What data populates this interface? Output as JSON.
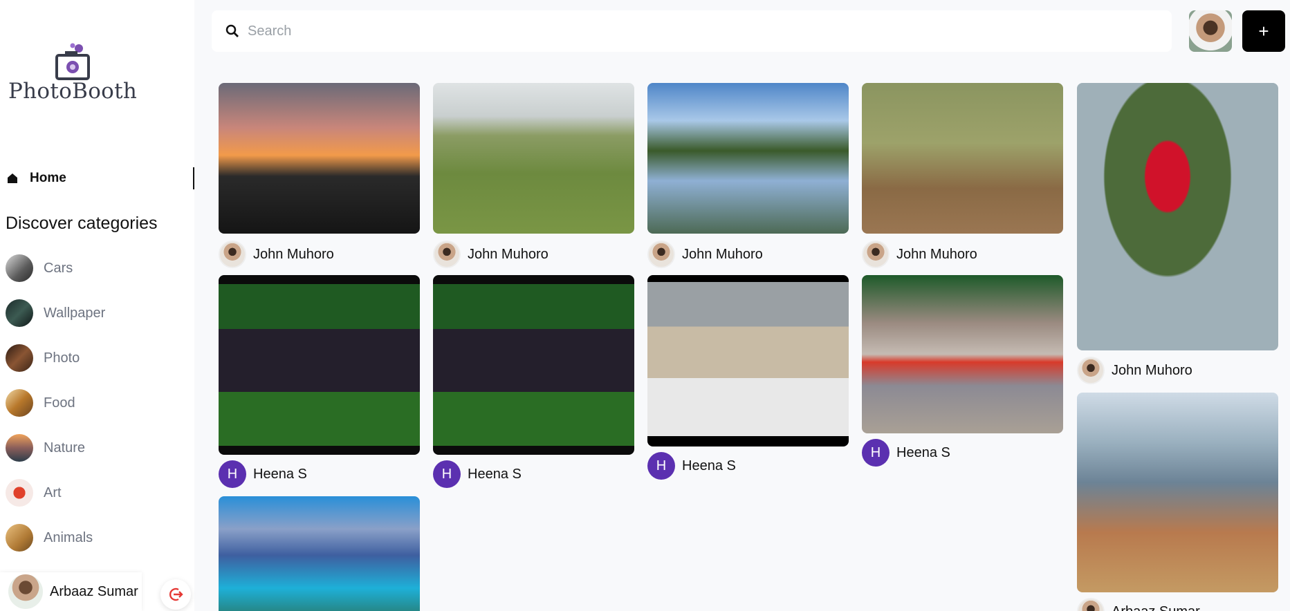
{
  "app": {
    "name": "PhotoBooth"
  },
  "nav": {
    "home_label": "Home"
  },
  "categories": {
    "title": "Discover categories",
    "items": [
      {
        "label": "Cars",
        "thumb": "linear-gradient(135deg,#d9d9d9,#5a5a5a 60%,#2b2b2b)"
      },
      {
        "label": "Wallpaper",
        "thumb": "linear-gradient(135deg,#1b2a2a,#3c5b52 50%,#0f1616)"
      },
      {
        "label": "Photo",
        "thumb": "linear-gradient(135deg,#2b1a12,#8a5533 50%,#3a2417)"
      },
      {
        "label": "Food",
        "thumb": "linear-gradient(135deg,#f0d9a6,#b8782b 50%,#6b4420)"
      },
      {
        "label": "Nature",
        "thumb": "linear-gradient(180deg,#f0a35b,#8b5e5a 50%,#2d3d4a)"
      },
      {
        "label": "Art",
        "thumb": "radial-gradient(circle,#e0412b 0 30%,#f6e9e6 31% 100%)"
      },
      {
        "label": "Animals",
        "thumb": "linear-gradient(135deg,#e9c07f,#b07a35 60%,#6e4a20)"
      }
    ]
  },
  "current_user": {
    "name": "Arbaaz Sumar"
  },
  "search": {
    "placeholder": "Search"
  },
  "actions": {
    "add_label": "+"
  },
  "pins": [
    {
      "author": "John Muhoro",
      "avatar": "photo",
      "image": "sunset-trees",
      "bg": "linear-gradient(180deg,#6b6a78 0%,#c9867a 30%,#f29a4a 48%,#2a2a2a 62%,#151515 100%)"
    },
    {
      "author": "John Muhoro",
      "avatar": "photo",
      "image": "buffalo-grass",
      "bg": "linear-gradient(180deg,#dfe3e4 0%,#c9cfcf 22%,#8b9c64 35%,#6d8a3f 60%,#7a9645 100%)"
    },
    {
      "author": "John Muhoro",
      "avatar": "photo",
      "image": "lake-reflection",
      "bg": "linear-gradient(180deg,#4f86c8 0%,#a9c8e8 25%,#3a5a2a 45%,#8fb0d4 65%,#4d6a55 100%)"
    },
    {
      "author": "John Muhoro",
      "avatar": "photo",
      "image": "zebras",
      "bg": "linear-gradient(180deg,#8b9560 0%,#9da26a 40%,#8a6a45 70%,#9a7652 100%)"
    },
    {
      "author": "John Muhoro",
      "avatar": "photo",
      "image": "red-rose",
      "bg": "radial-gradient(ellipse at 45% 35%,#d0122a 0 14%,#4d6b3a 15% 40%,#9fb0b8 41% 100%)"
    },
    {
      "author": "Heena S",
      "avatar": "letter",
      "letter": "H",
      "image": "house-night",
      "bg": "linear-gradient(180deg,#0b0b0b 0 5%,#1f5a22 5% 30%,#241f2c 30% 65%,#2a6d24 65% 95%,#0b0b0b 95% 100%)"
    },
    {
      "author": "Heena S",
      "avatar": "letter",
      "letter": "H",
      "image": "house-night-2",
      "bg": "linear-gradient(180deg,#0b0b0b 0 5%,#1f5a22 5% 30%,#241f2c 30% 65%,#2a6d24 65% 95%,#0b0b0b 95% 100%)"
    },
    {
      "author": "Heena S",
      "avatar": "letter",
      "letter": "H",
      "image": "snow-leopard",
      "bg": "linear-gradient(180deg,#000 0 4%,#9aa0a4 4% 30%,#c8bba5 30% 60%,#e8e8e8 60% 94%,#000 94% 100%)"
    },
    {
      "author": "Heena S",
      "avatar": "letter",
      "letter": "H",
      "image": "sports-car",
      "bg": "linear-gradient(180deg,#1e5a2a 0%,#9a8a80 30%,#c5bbb3 50%,#d83a2a 55%,#8c8a94 70%,#a9a095 100%)"
    },
    {
      "author": "Arbaaz Sumar",
      "avatar": "photo",
      "image": "mountain-jeep",
      "bg": "linear-gradient(180deg,#cfdbe6 0%,#9ab0bf 25%,#6c8396 45%,#b87a4e 70%,#c49a63 100%)"
    },
    {
      "author": "",
      "avatar": "none",
      "image": "mountain-lake",
      "bg": "linear-gradient(180deg,#2a8fd8 0%,#8aa0c8 25%,#3e5fa0 45%,#1eb0d8 70%,#2b6b4f 100%)"
    }
  ]
}
